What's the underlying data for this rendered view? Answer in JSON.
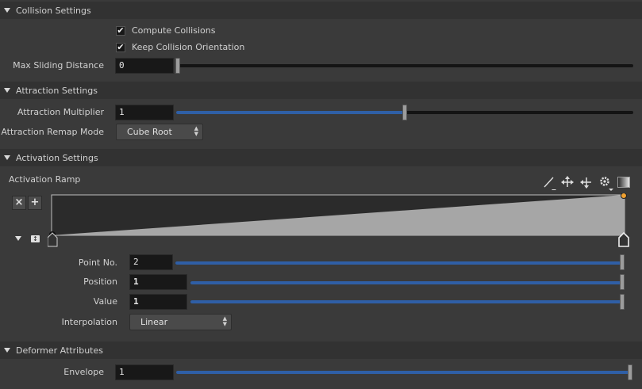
{
  "collision": {
    "title": "Collision Settings",
    "compute_label": "Compute Collisions",
    "compute_checked": true,
    "keep_orient_label": "Keep Collision Orientation",
    "keep_orient_checked": true,
    "max_slide_label": "Max Sliding Distance",
    "max_slide_value": "0",
    "max_slide_fraction": 0
  },
  "attraction": {
    "title": "Attraction Settings",
    "multiplier_label": "Attraction Multiplier",
    "multiplier_value": "1",
    "multiplier_fraction": 0.5,
    "remap_label": "Attraction Remap Mode",
    "remap_value": "Cube Root"
  },
  "activation": {
    "title": "Activation Settings",
    "ramp_label": "Activation Ramp",
    "delete_glyph": "×",
    "add_glyph": "+",
    "point_no_label": "Point No.",
    "point_no_value": "2",
    "position_label": "Position",
    "position_value": "1",
    "value_label": "Value",
    "value_value": "1",
    "interp_label": "Interpolation",
    "interp_value": "Linear",
    "ramp_points": [
      {
        "position": 0,
        "value": 0
      },
      {
        "position": 1,
        "value": 1
      }
    ]
  },
  "deformer": {
    "title": "Deformer Attributes",
    "envelope_label": "Envelope",
    "envelope_value": "1",
    "envelope_fraction": 1
  },
  "colors": {
    "panel_bg": "#3a3a3a",
    "header_bg": "#323232",
    "slider_fill": "#2f5fa6",
    "field_bg": "#181818",
    "ramp_fill": "#a6a6a6",
    "ramp_bg": "#2b2b2b",
    "selected_key": "#f0a030"
  }
}
